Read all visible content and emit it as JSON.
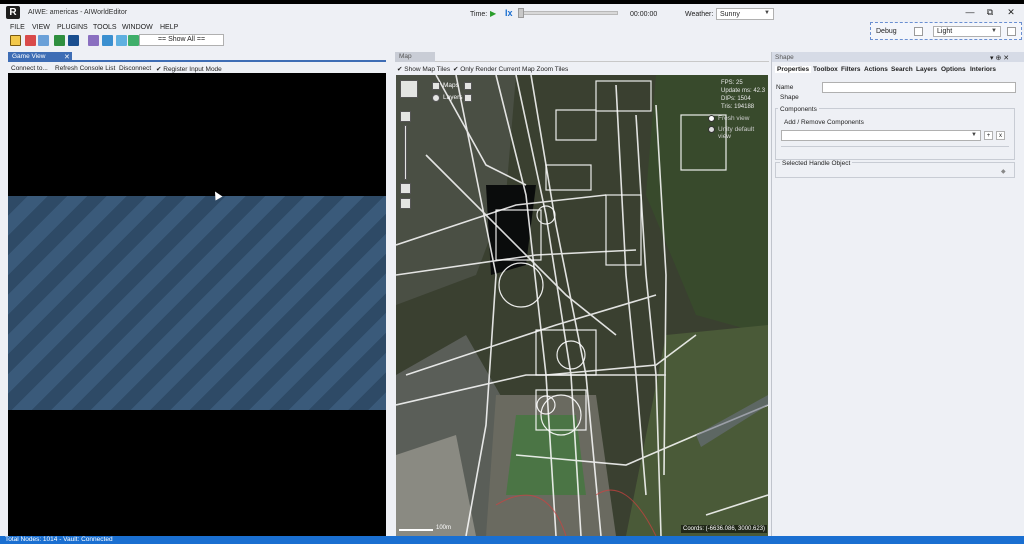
{
  "app": {
    "logo": "R",
    "title": "AIWE: americas - AIWorldEditor"
  },
  "window_controls": {
    "minimize": "—",
    "restore": "⧉",
    "close": "✕"
  },
  "timebar": {
    "time_label": "Time:",
    "play_icon": "▶",
    "speed_icon": "Ix",
    "time_value": "00:00:00",
    "weather_label": "Weather:",
    "weather_value": "Sunny"
  },
  "debug": {
    "label": "Debug",
    "light_value": "Light"
  },
  "menu": {
    "items": [
      "FILE",
      "VIEW",
      "PLUGINS",
      "TOOLS",
      "WINDOW",
      "HELP"
    ]
  },
  "toolbar": {
    "show_all": "== Show All =="
  },
  "game_view": {
    "tab_label": "Game View",
    "tab_close": "✕",
    "commands": [
      "Connect to...",
      "Refresh Console List",
      "Disconnect"
    ],
    "register_input": "✔ Register Input Mode"
  },
  "map": {
    "tab_label": "Map",
    "show_tiles": "✔ Show Map Tiles",
    "only_render": "✔ Only Render Current Map Zoom Tiles",
    "maps_label": "Maps",
    "layers_label": "Layers",
    "stats": [
      "FPS: 25",
      "Update ms: 42.3",
      "DIPs: 1504",
      "Tris: 194188"
    ],
    "option_1": "Fresh view",
    "option_2": "Unity default view",
    "scale": "100m",
    "coords": "Coords: (-6636.086, 3000.623)"
  },
  "shape_panel": {
    "title": "Shape",
    "pin": "▾ ⊕ ✕",
    "tabs": [
      "Properties",
      "Toolbox",
      "Filters",
      "Actions",
      "Search",
      "Layers",
      "Options",
      "Interiors"
    ],
    "name_label": "Name",
    "shape_label": "Shape",
    "components_title": "Components",
    "add_remove": "Add / Remove Components",
    "add_btn": "+",
    "remove_btn": "x",
    "handle_title": "Selected Handle Object",
    "handle_icon": "◆"
  },
  "status": {
    "text": "Total Nodes: 1014 - Vault: Connected"
  }
}
